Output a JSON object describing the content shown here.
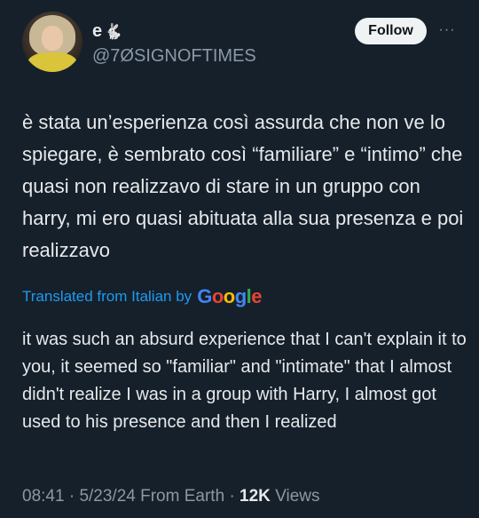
{
  "author": {
    "display_name": "e",
    "handle": "@7ØSIGNOFTIMES",
    "badge_icon": "rabbit-icon",
    "badge_glyph": "🐇"
  },
  "follow_button_label": "Follow",
  "more_icon": "···",
  "tweet": {
    "text": "è stata un’esperienza così assurda che non ve lo spiegare, è sembrato così “familiare” e “intimo” che quasi non realizzavo di stare in un gruppo con harry, mi ero quasi abituata alla sua presenza e poi realizzavo",
    "translated_label": "Translated from Italian by",
    "translation_provider": "Google",
    "translation": "it was such an absurd experience that I can't explain it to you, it seemed so \"familiar\" and \"intimate\" that I almost didn't realize I was in a group with Harry, I almost got used to his presence and then I realized"
  },
  "meta": {
    "time": "08:41",
    "date": "5/23/24",
    "separator": "·",
    "source": "From Earth",
    "views_count": "12K",
    "views_label": "Views"
  },
  "colors": {
    "background": "#15202b",
    "text": "#e7e9ea",
    "muted": "#8b98a5",
    "link": "#1d9bf0"
  }
}
